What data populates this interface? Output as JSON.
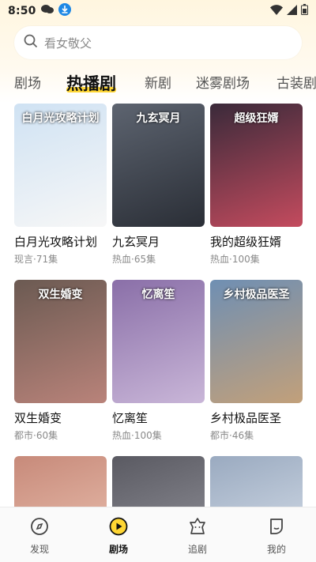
{
  "status_bar": {
    "time": "8:50"
  },
  "search": {
    "placeholder": "看女敬父"
  },
  "tabs": [
    {
      "label": "剧场"
    },
    {
      "label": "热播剧"
    },
    {
      "label": "新剧"
    },
    {
      "label": "迷雾剧场"
    },
    {
      "label": "古装剧"
    }
  ],
  "dramas": [
    {
      "title": "白月光攻略计划",
      "poster_text": "白月光攻略计划",
      "meta": "现言·71集",
      "colors": [
        "#cfe2f3",
        "#f7f7f7"
      ]
    },
    {
      "title": "九玄冥月",
      "poster_text": "九玄冥月",
      "meta": "热血·65集",
      "colors": [
        "#5d6470",
        "#2a2e36"
      ]
    },
    {
      "title": "我的超级狂婿",
      "poster_text": "超级狂婿",
      "meta": "热血·100集",
      "colors": [
        "#3a2a3a",
        "#c44b5e"
      ]
    },
    {
      "title": "双生婚变",
      "poster_text": "双生婚变",
      "meta": "都市·60集",
      "colors": [
        "#6b5a52",
        "#b9837a"
      ]
    },
    {
      "title": "忆离笙",
      "poster_text": "忆离笙",
      "meta": "热血·100集",
      "colors": [
        "#8a6fa8",
        "#c9b6d8"
      ]
    },
    {
      "title": "乡村极品医圣",
      "poster_text": "乡村极品医圣",
      "meta": "都市·46集",
      "colors": [
        "#6f8fb3",
        "#c2a07a"
      ]
    },
    {
      "title": "",
      "poster_text": "",
      "meta": "",
      "colors": [
        "#c78a7a",
        "#f0c9b8"
      ]
    },
    {
      "title": "",
      "poster_text": "",
      "meta": "",
      "colors": [
        "#5a5a62",
        "#9a9aa2"
      ]
    },
    {
      "title": "",
      "poster_text": "",
      "meta": "",
      "colors": [
        "#9aaac0",
        "#dfe6ef"
      ]
    }
  ],
  "bottom_nav": [
    {
      "label": "发现",
      "icon": "discover-icon"
    },
    {
      "label": "剧场",
      "icon": "theater-icon"
    },
    {
      "label": "追剧",
      "icon": "follow-icon"
    },
    {
      "label": "我的",
      "icon": "profile-icon"
    }
  ],
  "colors": {
    "accent": "#ffd633",
    "text": "#111111",
    "muted": "#8a8a8a"
  }
}
